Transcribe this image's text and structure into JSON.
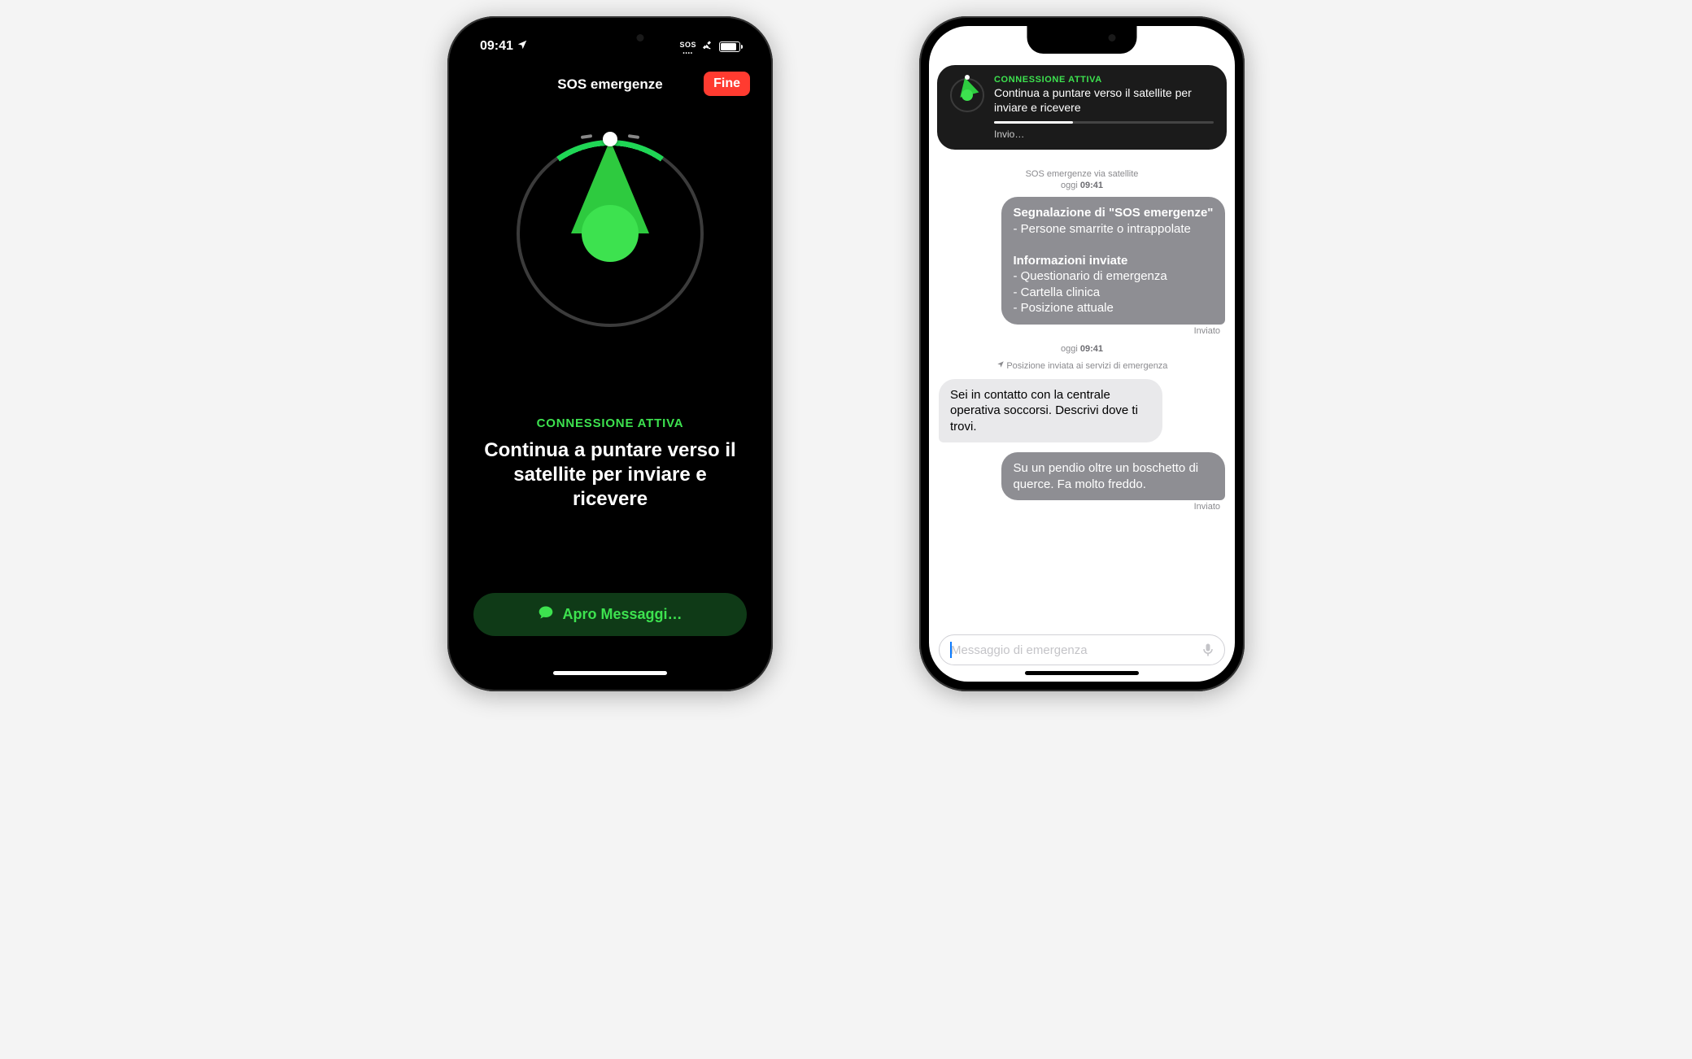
{
  "status": {
    "time": "09:41",
    "sos_label": "SOS"
  },
  "phone1": {
    "nav_title": "SOS emergenze",
    "done": "Fine",
    "connection_active": "CONNESSIONE ATTIVA",
    "instruction": "Continua a puntare verso il satellite per inviare e ricevere",
    "open_messages": "Apro Messaggi…"
  },
  "phone2": {
    "banner": {
      "title": "CONNESSIONE ATTIVA",
      "text": "Continua a puntare verso il satellite per inviare e ricevere",
      "sending": "Invio…"
    },
    "thread_header": "SOS emergenze via satellite",
    "time_prefix": "oggi ",
    "time_value": "09:41",
    "msg1": {
      "title": "Segnalazione di \"SOS emergenze\"",
      "line1": "- Persone smarrite o intrappolate",
      "info_title": "Informazioni inviate",
      "info1": "- Questionario di emergenza",
      "info2": "- Cartella clinica",
      "info3": "- Posizione attuale"
    },
    "sent": "Inviato",
    "loc_time_prefix": "oggi ",
    "loc_time_value": "09:41",
    "location_sent": "Posizione inviata ai servizi di emergenza",
    "msg_in": "Sei in contatto con la centrale operativa soccorsi. Descrivi dove ti trovi.",
    "msg_out2": "Su un pendio oltre un boschetto di querce. Fa molto freddo.",
    "input_placeholder": "Messaggio di emergenza"
  }
}
